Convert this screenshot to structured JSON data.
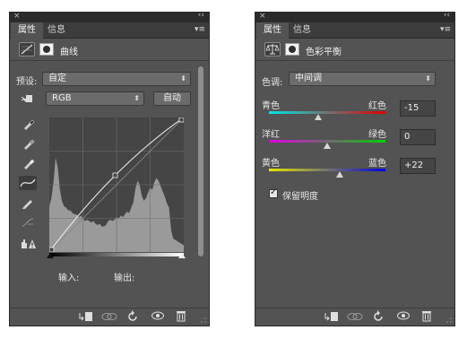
{
  "curves_panel": {
    "close_glyph": "×",
    "collapse_glyph": "‹‹",
    "tab_properties": "属性",
    "tab_info": "信息",
    "title": "曲线",
    "preset_label": "预设:",
    "preset_value": "自定",
    "channel_value": "RGB",
    "auto_label": "自动",
    "input_label": "输入:",
    "output_label": "输出:",
    "histogram": [
      0.34,
      0.4,
      0.52,
      0.7,
      0.63,
      0.47,
      0.38,
      0.34,
      0.33,
      0.31,
      0.31,
      0.29,
      0.28,
      0.28,
      0.26,
      0.27,
      0.25,
      0.23,
      0.24,
      0.23,
      0.22,
      0.23,
      0.21,
      0.2,
      0.21,
      0.19,
      0.19,
      0.2,
      0.23,
      0.24,
      0.23,
      0.24,
      0.26,
      0.25,
      0.27,
      0.26,
      0.28,
      0.3,
      0.29,
      0.33,
      0.37,
      0.47,
      0.53,
      0.5,
      0.42,
      0.38,
      0.4,
      0.44,
      0.48,
      0.46,
      0.52,
      0.55,
      0.53,
      0.49,
      0.45,
      0.41,
      0.36,
      0.33,
      0.16,
      0.1,
      0.09,
      0.08,
      0.07,
      0.06,
      0.05
    ],
    "curve_points": [
      [
        0,
        0
      ],
      [
        0.49,
        0.57
      ],
      [
        1,
        1
      ]
    ]
  },
  "color_balance_panel": {
    "close_glyph": "×",
    "collapse_glyph": "‹‹",
    "tab_properties": "属性",
    "tab_info": "信息",
    "title": "色彩平衡",
    "tone_label": "色调:",
    "tone_value": "中间调",
    "sliders": [
      {
        "left": "青色",
        "right": "红色",
        "value": "-15",
        "level": -15
      },
      {
        "left": "洋红",
        "right": "绿色",
        "value": "0",
        "level": 0
      },
      {
        "left": "黄色",
        "right": "蓝色",
        "value": "+22",
        "level": 22
      }
    ],
    "preserve_label": "保留明度",
    "preserve_checked": true
  }
}
